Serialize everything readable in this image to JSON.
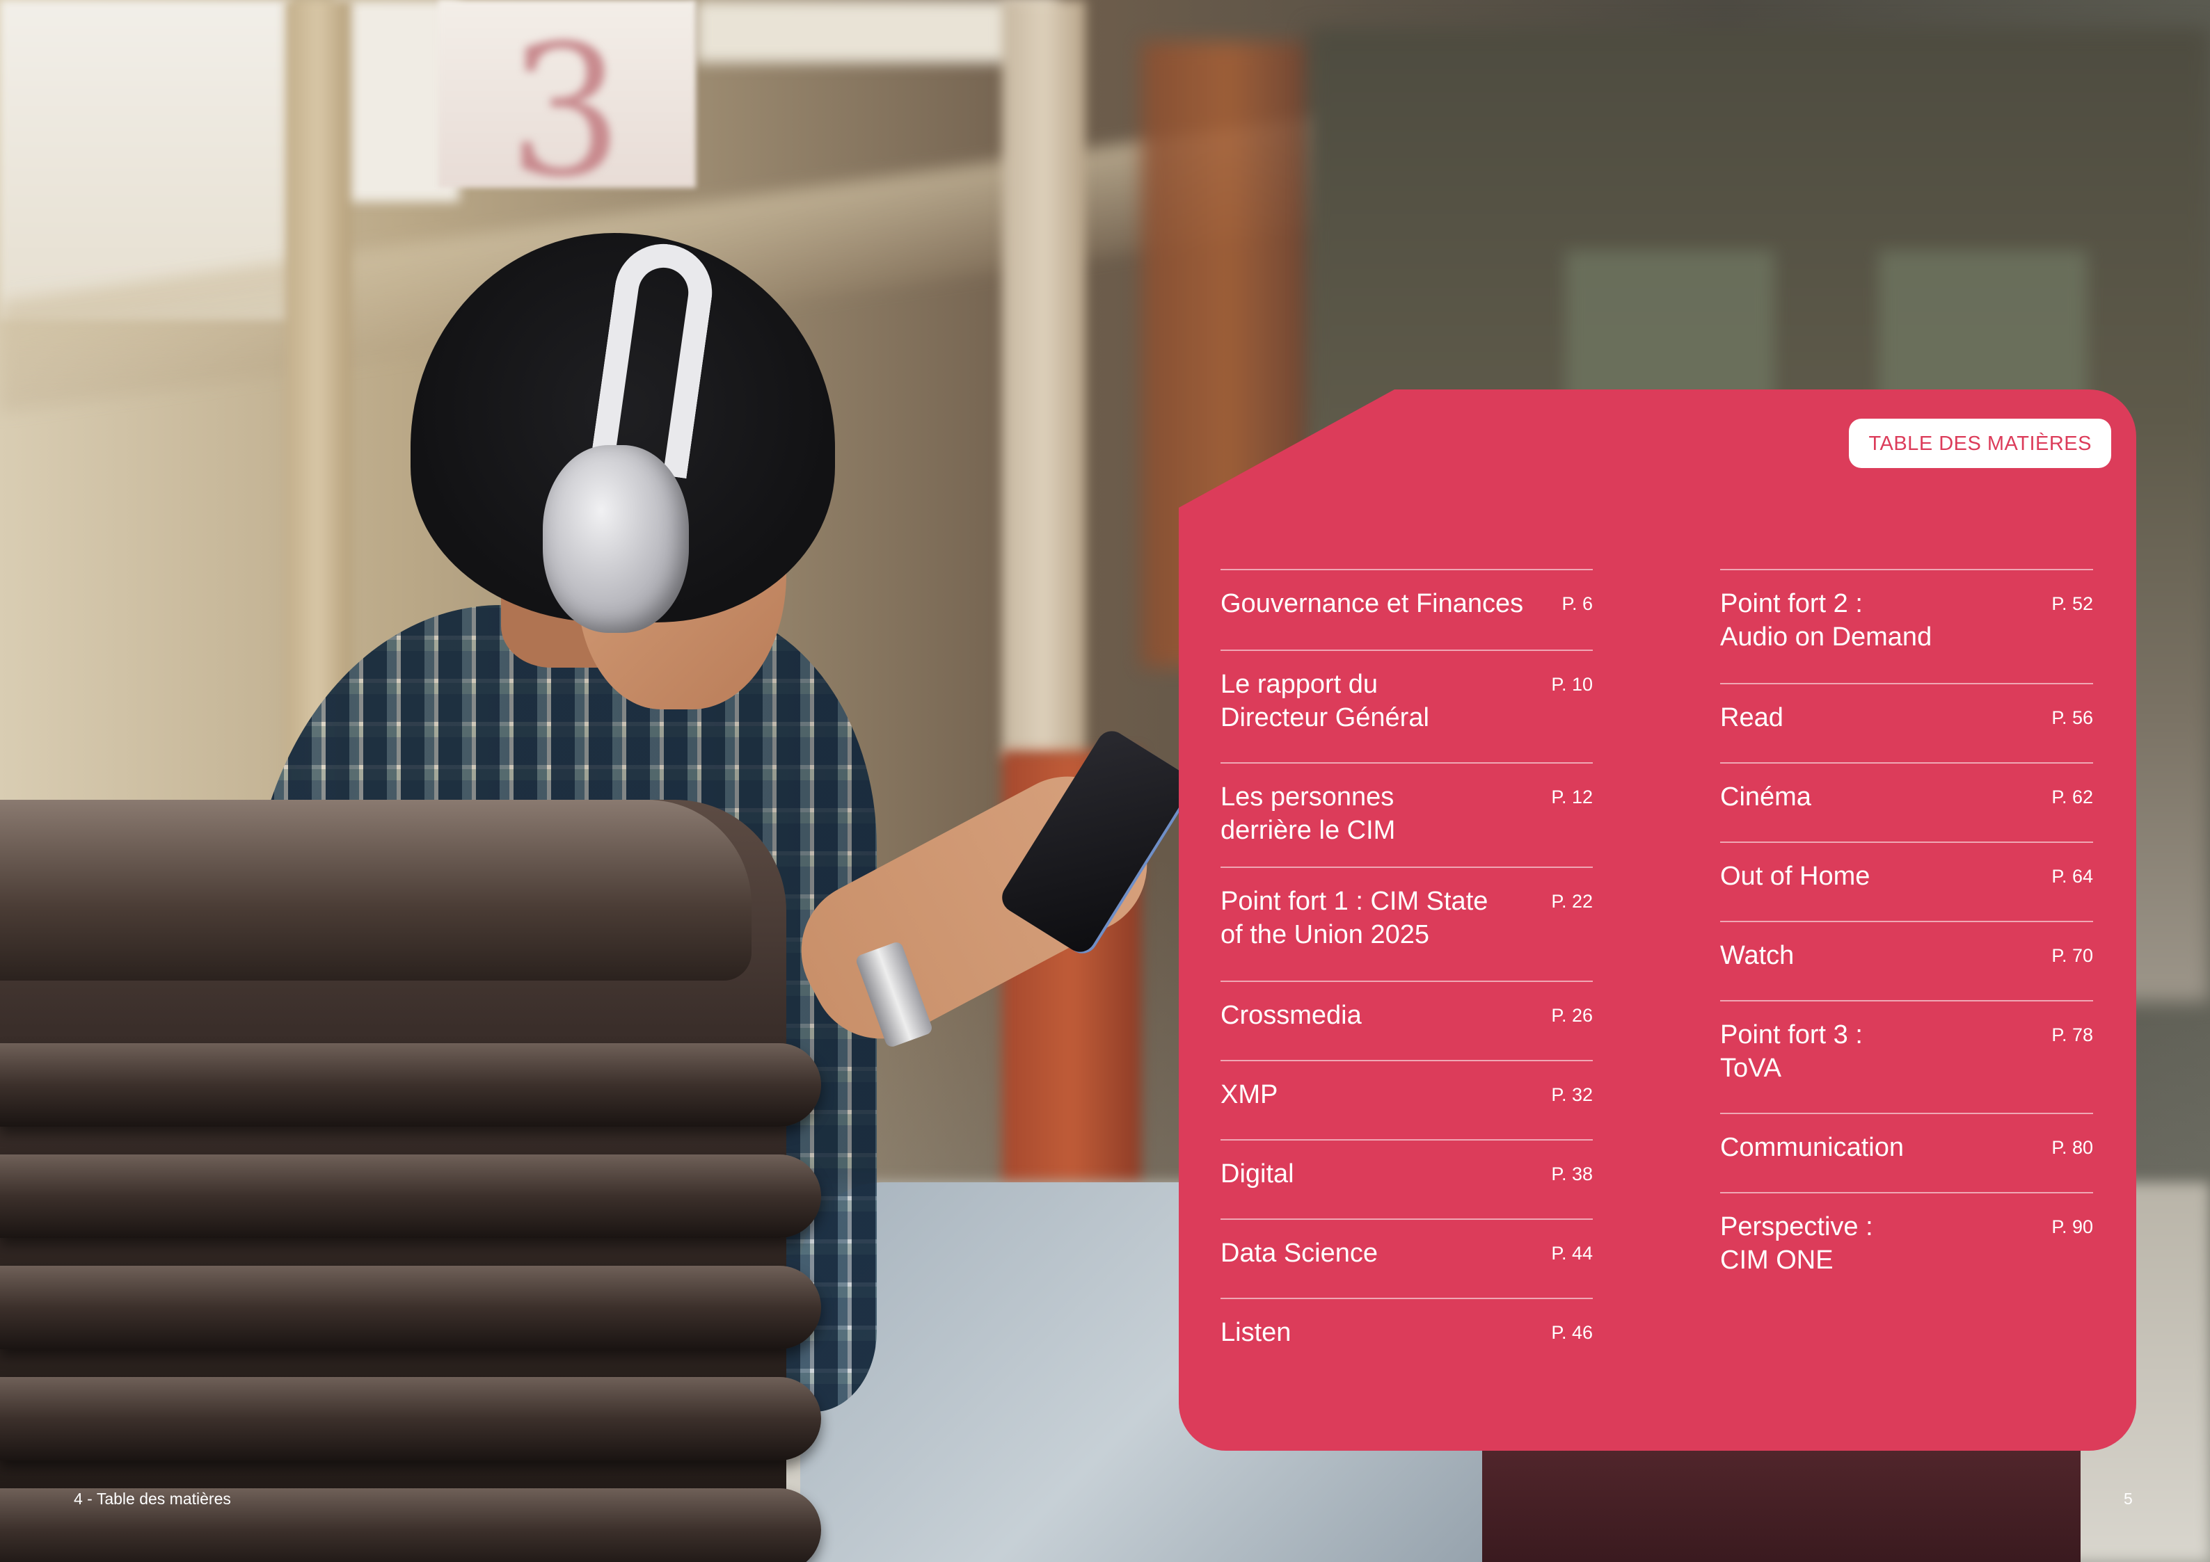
{
  "toc": {
    "badge": "TABLE DES MATIÈRES",
    "left_column": [
      {
        "title": "Gouvernance et Finances",
        "page": "P. 6"
      },
      {
        "title": "Le rapport du\nDirecteur Général",
        "page": "P. 10"
      },
      {
        "title": "Les personnes\nderrière le CIM",
        "page": "P. 12"
      },
      {
        "title": "Point fort 1 : CIM State\nof the Union 2025",
        "page": "P. 22"
      },
      {
        "title": "Crossmedia",
        "page": "P. 26"
      },
      {
        "title": "XMP",
        "page": "P. 32"
      },
      {
        "title": "Digital",
        "page": "P. 38"
      },
      {
        "title": "Data Science",
        "page": "P. 44"
      },
      {
        "title": "Listen",
        "page": "P. 46"
      }
    ],
    "right_column": [
      {
        "title": "Point fort 2 :\nAudio on Demand",
        "page": "P. 52"
      },
      {
        "title": "Read",
        "page": "P. 56"
      },
      {
        "title": "Cinéma",
        "page": "P. 62"
      },
      {
        "title": "Out of Home",
        "page": "P. 64"
      },
      {
        "title": "Watch",
        "page": "P. 70"
      },
      {
        "title": "Point fort 3 :\nToVA",
        "page": "P. 78"
      },
      {
        "title": "Communication",
        "page": "P. 80"
      },
      {
        "title": "Perspective :\nCIM ONE",
        "page": "P. 90"
      }
    ]
  },
  "footer": {
    "left": "4 - Table des matières",
    "right": "5"
  },
  "colors": {
    "accent": "#dc3c5a",
    "badge_bg": "#ffffff",
    "text_on_accent": "#ffffff"
  },
  "photo": {
    "sign_number": "3"
  }
}
